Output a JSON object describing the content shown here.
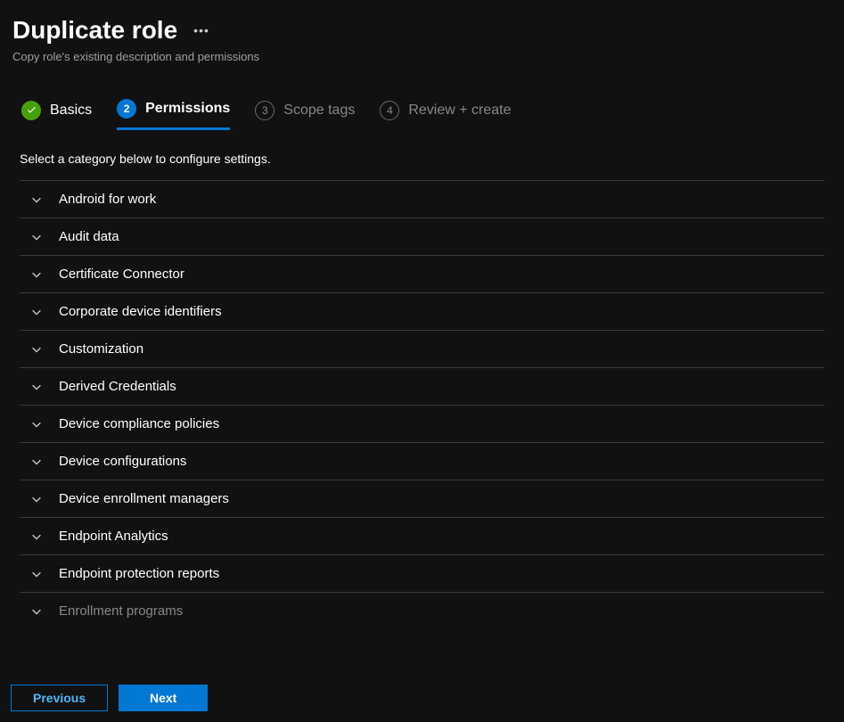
{
  "header": {
    "title": "Duplicate role",
    "subtitle": "Copy role's existing description and permissions"
  },
  "tabs": [
    {
      "label": "Basics",
      "state": "completed"
    },
    {
      "label": "Permissions",
      "state": "active",
      "number": "2"
    },
    {
      "label": "Scope tags",
      "state": "inactive",
      "number": "3"
    },
    {
      "label": "Review + create",
      "state": "inactive",
      "number": "4"
    }
  ],
  "instruction": "Select a category below to configure settings.",
  "categories": [
    {
      "label": "Android for work"
    },
    {
      "label": "Audit data"
    },
    {
      "label": "Certificate Connector"
    },
    {
      "label": "Corporate device identifiers"
    },
    {
      "label": "Customization"
    },
    {
      "label": "Derived Credentials"
    },
    {
      "label": "Device compliance policies"
    },
    {
      "label": "Device configurations"
    },
    {
      "label": "Device enrollment managers"
    },
    {
      "label": "Endpoint Analytics"
    },
    {
      "label": "Endpoint protection reports"
    },
    {
      "label": "Enrollment programs"
    }
  ],
  "footer": {
    "previous_label": "Previous",
    "next_label": "Next"
  }
}
